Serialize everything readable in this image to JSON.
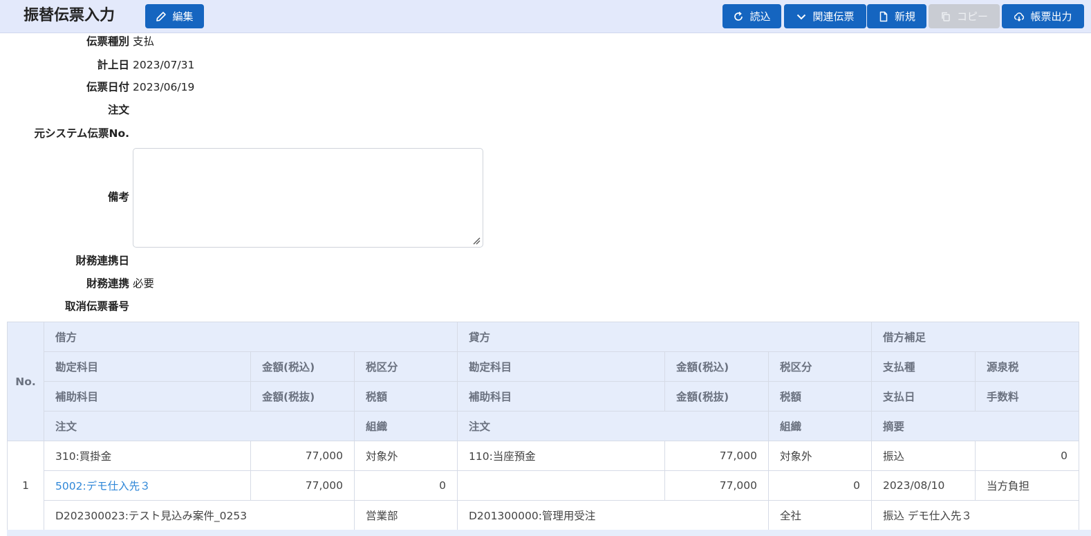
{
  "header": {
    "title": "振替伝票入力",
    "edit_label": "編集",
    "buttons": {
      "reload": "読込",
      "related": "関連伝票",
      "new": "新規",
      "copy": "コピー",
      "print": "帳票出力"
    }
  },
  "form": {
    "voucher_type": {
      "label": "伝票種別",
      "value": "支払"
    },
    "posting_date": {
      "label": "計上日",
      "value": "2023/07/31"
    },
    "voucher_date": {
      "label": "伝票日付",
      "value": "2023/06/19"
    },
    "order": {
      "label": "注文",
      "value": ""
    },
    "source_voucher_no": {
      "label": "元システム伝票No.",
      "value": ""
    },
    "remarks": {
      "label": "備考",
      "value": ""
    },
    "finance_link_date": {
      "label": "財務連携日",
      "value": ""
    },
    "finance_link": {
      "label": "財務連携",
      "value": "必要"
    },
    "cancel_voucher_no": {
      "label": "取消伝票番号",
      "value": ""
    }
  },
  "table": {
    "headers": {
      "no": "No.",
      "debit": "借方",
      "credit": "貸方",
      "debit_supplement": "借方補足",
      "account": "勘定科目",
      "amount_incl": "金額(税込)",
      "tax_class": "税区分",
      "sub_account": "補助科目",
      "amount_excl": "金額(税抜)",
      "tax_amount": "税額",
      "order": "注文",
      "org": "組織",
      "payment_type": "支払種",
      "withholding": "源泉税",
      "payment_date": "支払日",
      "fee": "手数料",
      "summary": "摘要"
    },
    "rows": [
      {
        "no": "1",
        "debit_account": "310:買掛金",
        "debit_amount_incl": "77,000",
        "debit_tax_class": "対象外",
        "credit_account": "110:当座預金",
        "credit_amount_incl": "77,000",
        "credit_tax_class": "対象外",
        "payment_type": "振込",
        "withholding": "0",
        "debit_sub_account": "5002:デモ仕入先３",
        "debit_amount_excl": "77,000",
        "debit_tax_amount": "0",
        "credit_sub_account": "",
        "credit_amount_excl": "77,000",
        "credit_tax_amount": "0",
        "payment_date": "2023/08/10",
        "fee": "当方負担",
        "debit_order": "D202300023:テスト見込み案件_0253",
        "debit_org": "営業部",
        "credit_order": "D201300000:管理用受注",
        "credit_org": "全社",
        "summary": "振込 デモ仕入先３"
      }
    ]
  },
  "colors": {
    "header_bg": "#e3e9fb",
    "button_primary": "#1565c0",
    "button_disabled": "#c9ccd3",
    "table_header_bg": "#e6edfb",
    "link": "#2f87d8"
  }
}
